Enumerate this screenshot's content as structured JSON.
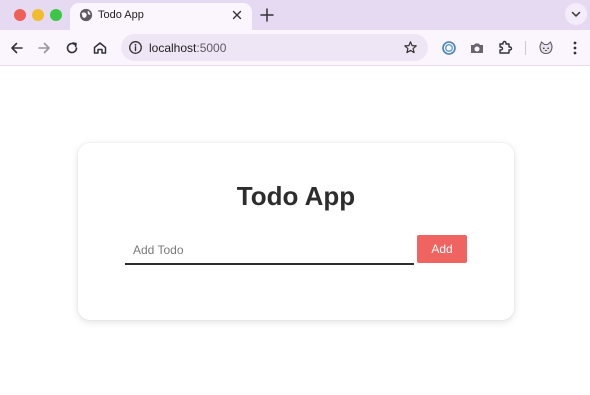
{
  "browser": {
    "tab": {
      "title": "Todo App",
      "favicon": "globe-icon"
    },
    "address": {
      "host": "localhost",
      "port": ":5000"
    },
    "icons": {
      "back": "arrow-left-icon",
      "forward": "arrow-right-icon",
      "reload": "reload-icon",
      "home": "home-icon",
      "site_info": "info-icon",
      "bookmark": "star-icon",
      "ext1": "ring-extension-icon",
      "ext2": "camera-extension-icon",
      "extensions": "puzzle-icon",
      "profile": "cat-avatar-icon",
      "menu": "kebab-menu-icon"
    },
    "colors": {
      "tabbar": "#e6daf2",
      "toolbar": "#fbf6fe",
      "omnibox": "#efe6f5"
    }
  },
  "app": {
    "title": "Todo App",
    "input": {
      "placeholder": "Add Todo",
      "value": ""
    },
    "add_button_label": "Add",
    "colors": {
      "accent": "#ef6360",
      "text": "#2d2d2d"
    }
  }
}
